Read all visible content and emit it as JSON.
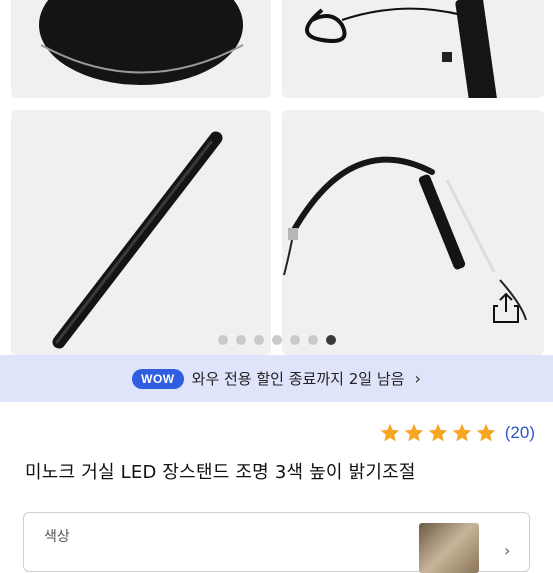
{
  "gallery": {
    "images": [
      {
        "icon": "lamp-base-image"
      },
      {
        "icon": "lamp-cable-image"
      },
      {
        "icon": "lamp-pole-image"
      },
      {
        "icon": "lamp-head-image"
      }
    ],
    "slide_count": 7,
    "active_slide": 7,
    "share_icon": "share-icon"
  },
  "wow_promo": {
    "badge": "WOW",
    "text": "와우 전용 할인 종료까지 2일 남음",
    "chevron": "›"
  },
  "rating": {
    "stars": 5,
    "star_color": "#f5a623",
    "review_count": "(20)"
  },
  "product": {
    "title": "미노크 거실 LED 장스탠드 조명 3색 높이 밝기조절"
  },
  "option": {
    "label": "색상",
    "chevron": "›"
  },
  "colors": {
    "wow_bar_bg": "#dfe4fa",
    "wow_badge": "#2f5fe0",
    "review_link": "#2d55c9"
  }
}
